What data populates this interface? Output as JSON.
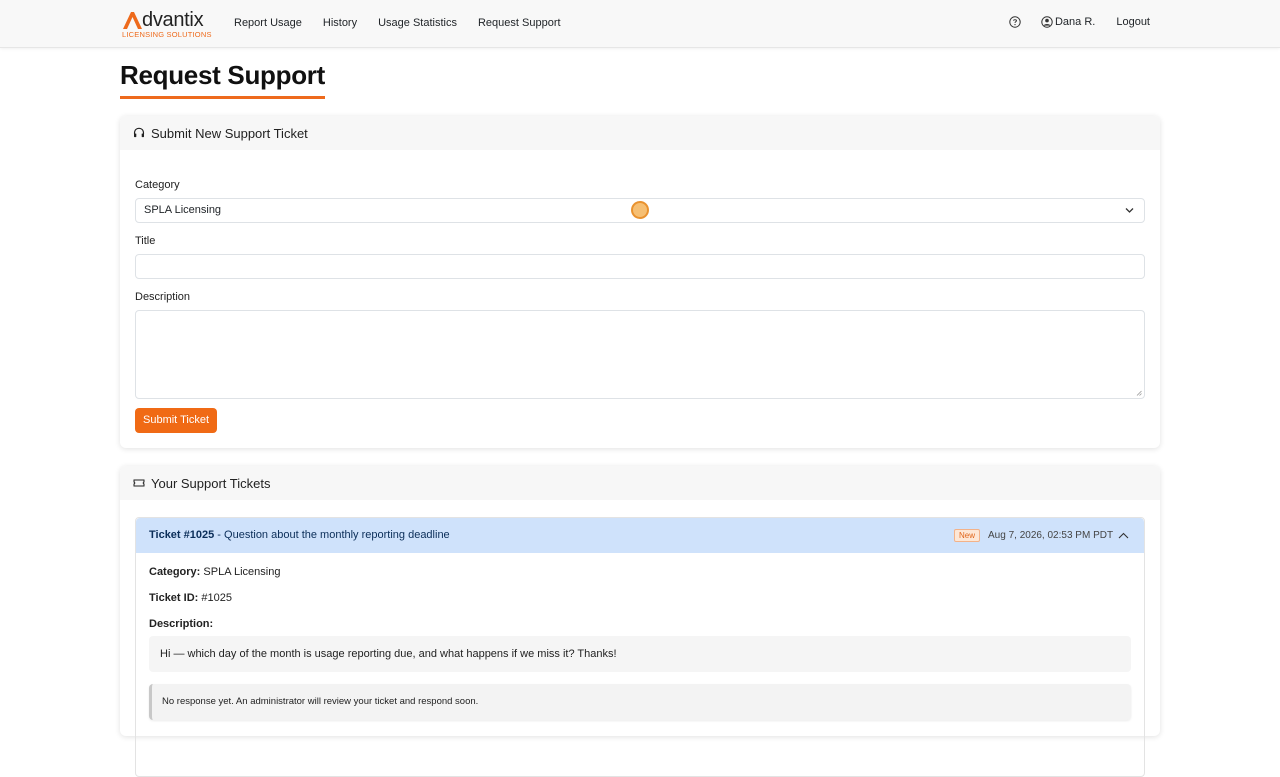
{
  "brand": {
    "name": "dvantix",
    "sub": "LICENSING SOLUTIONS",
    "accent": "#ee6a1c"
  },
  "nav": {
    "links": [
      "Report Usage",
      "History",
      "Usage Statistics",
      "Request Support"
    ],
    "user": "Dana R.",
    "logout": "Logout"
  },
  "page": {
    "title": "Request Support"
  },
  "form": {
    "header": "Submit New Support Ticket",
    "category_label": "Category",
    "category_value": "SPLA Licensing",
    "title_label": "Title",
    "title_value": "",
    "description_label": "Description",
    "description_value": "",
    "submit_label": "Submit Ticket"
  },
  "tickets": {
    "header": "Your Support Tickets",
    "items": [
      {
        "number": "Ticket #1025",
        "subject": " - Question about the monthly reporting deadline",
        "status": "New",
        "date": "Aug 7, 2026, 02:53 PM PDT",
        "category_label": "Category:",
        "category": " SPLA Licensing",
        "id_label": "Ticket ID:",
        "id": " #1025",
        "description_label": "Description:",
        "description": "Hi — which day of the month is usage reporting due, and what happens if we miss it? Thanks!",
        "response": "No response yet. An administrator will review your ticket and respond soon."
      }
    ]
  }
}
